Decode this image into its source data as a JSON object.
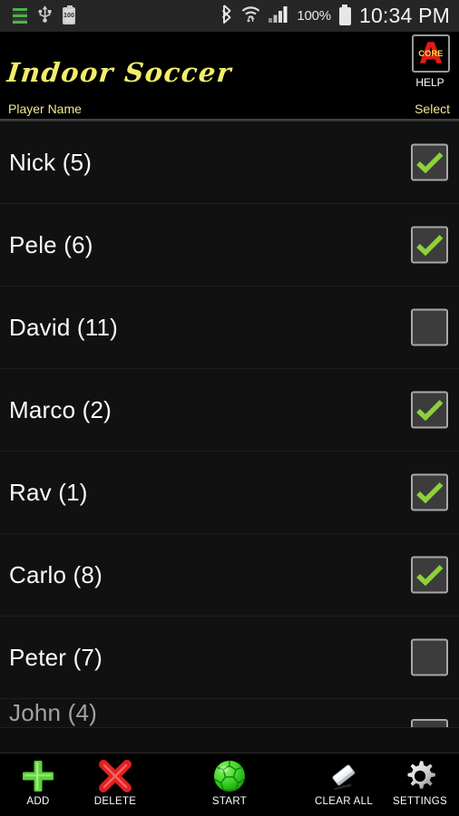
{
  "status_bar": {
    "left_icons": [
      "equalizer-bars-icon",
      "usb-icon",
      "battery-100-icon"
    ],
    "battery_inline_text": "100",
    "right_icons": [
      "bluetooth-icon",
      "wifi-icon",
      "cellular-signal-icon"
    ],
    "battery_percent": "100%",
    "clock": "10:34 PM"
  },
  "header": {
    "app_title": "Indoor Soccer",
    "help_label": "HELP",
    "help_icon_letter": "A",
    "help_icon_text": "CORE"
  },
  "columns": {
    "name_label": "Player Name",
    "select_label": "Select"
  },
  "players": [
    {
      "name": "Nick (5)",
      "selected": true
    },
    {
      "name": "Pele (6)",
      "selected": true
    },
    {
      "name": "David (11)",
      "selected": false
    },
    {
      "name": "Marco (2)",
      "selected": true
    },
    {
      "name": "Rav (1)",
      "selected": true
    },
    {
      "name": "Carlo (8)",
      "selected": true
    },
    {
      "name": "Peter (7)",
      "selected": false
    },
    {
      "name": "John (4)",
      "selected": false,
      "clipped": true
    }
  ],
  "toolbar": [
    {
      "label": "ADD",
      "icon": "plus-icon",
      "color": "#5bd33a"
    },
    {
      "label": "DELETE",
      "icon": "cross-x-icon",
      "color": "#e02020"
    },
    {
      "label": "START",
      "icon": "soccer-ball-icon",
      "color": "#3ed42a"
    },
    {
      "label": "CLEAR ALL",
      "icon": "eraser-icon",
      "color": "#f2f2f2"
    },
    {
      "label": "SETTINGS",
      "icon": "gear-icon",
      "color": "#cfcfcf"
    }
  ],
  "colors": {
    "accent_yellow": "#f2ed6a",
    "header_yellow": "#f0e890",
    "check_green": "#8ed13a",
    "row_bg": "#111111",
    "screen_bg": "#000000"
  }
}
